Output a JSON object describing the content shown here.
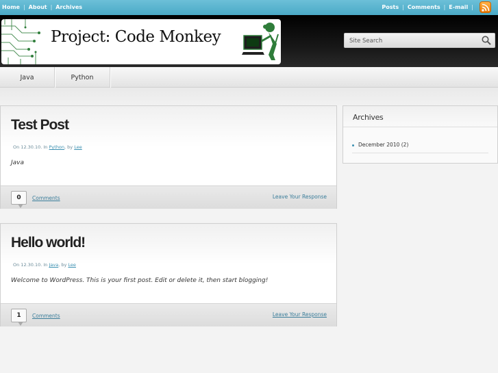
{
  "topbar": {
    "left_links": [
      "Home",
      "About",
      "Archives"
    ],
    "right_links": [
      "Posts",
      "Comments",
      "E-mail"
    ],
    "separator": "|",
    "rss_icon": "rss-icon"
  },
  "header": {
    "logo_text": "Project: Code Monkey",
    "search_placeholder": "Site Search",
    "search_icon": "magnifier-icon"
  },
  "nav": {
    "items": [
      "Java",
      "Python"
    ]
  },
  "posts": [
    {
      "title": "Test Post",
      "meta_prefix": "On 12.30.10. In",
      "category": "Python",
      "by": ", by",
      "author": "Lee",
      "excerpt": "Java",
      "comment_count": "0",
      "comments_label": "Comments",
      "leave_label": "Leave Your Response"
    },
    {
      "title": "Hello world!",
      "meta_prefix": "On 12.30.10. In",
      "category": "Java",
      "by": ", by",
      "author": "Lee",
      "excerpt": "Welcome to WordPress. This is your first post. Edit or delete it, then start blogging!",
      "comment_count": "1",
      "comments_label": "Comments",
      "leave_label": "Leave Your Response"
    }
  ],
  "sidebar": {
    "title": "Archives",
    "items": [
      "December 2010 (2)"
    ]
  },
  "colors": {
    "topbar": "#4aa9c6",
    "link": "#3a8fb0",
    "rss": "#e97a06"
  }
}
